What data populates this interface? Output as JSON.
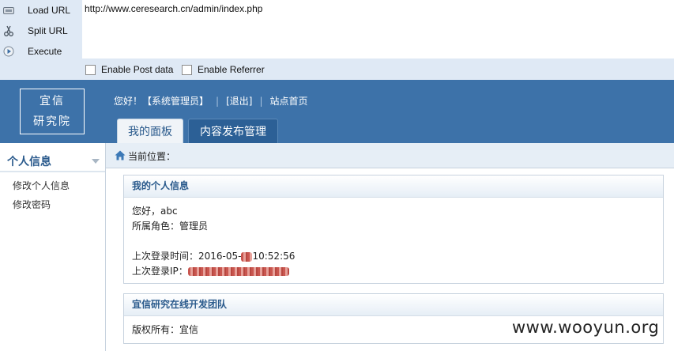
{
  "hackbar": {
    "buttons": [
      {
        "label": "Load URL",
        "icon": "load-url-icon"
      },
      {
        "label": "Split URL",
        "icon": "scissors-icon"
      },
      {
        "label": "Execute",
        "icon": "play-icon"
      }
    ],
    "url": "http://www.ceresearch.cn/admin/index.php",
    "enable_post": "Enable Post data",
    "enable_referrer": "Enable Referrer"
  },
  "header": {
    "logo_line1": "宜信",
    "logo_line2": "研究院",
    "greeting": "您好！【系统管理员】",
    "logout": "[退出]",
    "home": "站点首页",
    "tabs": [
      "我的面板",
      "内容发布管理"
    ],
    "colors": {
      "header_bg": "#3d72a9",
      "active_tab_bg": "#f0f4f8",
      "inactive_tab_bg": "#2c6096"
    }
  },
  "sidebar": {
    "title": "个人信息",
    "items": [
      "修改个人信息",
      "修改密码"
    ]
  },
  "breadcrumb": {
    "label": "当前位置："
  },
  "panels": {
    "profile": {
      "title": "我的个人信息",
      "hello": "您好，abc",
      "role": "所属角色：管理员",
      "last_login_prefix": "上次登录时间：2016-05-",
      "last_login_suffix": "10:52:56",
      "last_ip_label": "上次登录IP："
    },
    "team": {
      "title": "宜信研究在线开发团队",
      "copyright": "版权所有：宜信"
    }
  },
  "watermark": "www.wooyun.org"
}
